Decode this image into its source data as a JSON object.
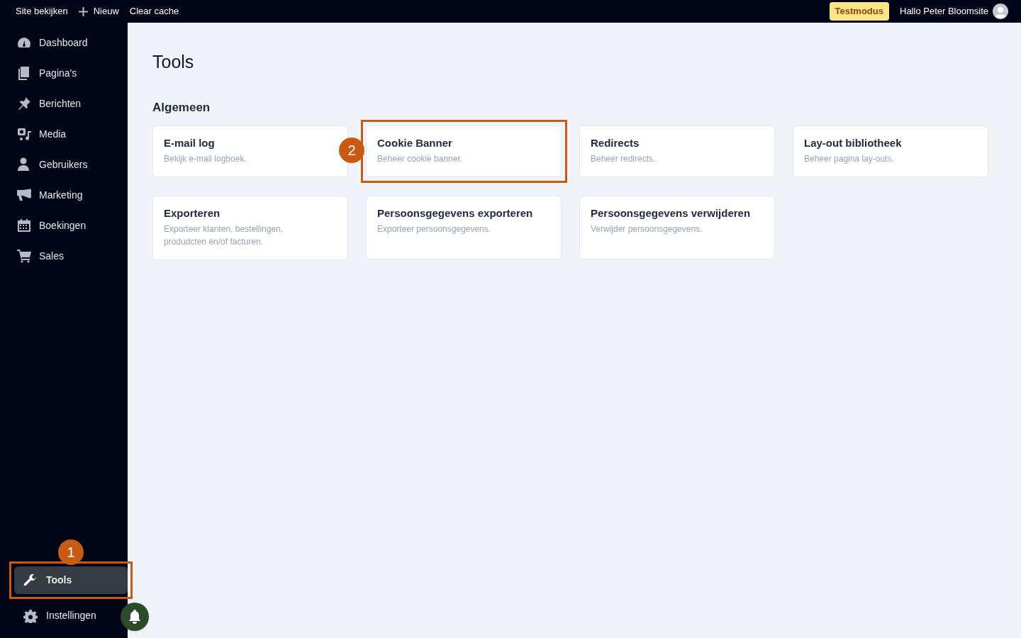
{
  "top_bar": {
    "links": [
      {
        "label": "Site bekijken",
        "kind": "plain"
      },
      {
        "label": "Nieuw",
        "kind": "add"
      },
      {
        "label": "Clear cache",
        "kind": "plain"
      }
    ],
    "badge": "Testmodus",
    "greeting": "Hallo Peter Bloomsite"
  },
  "sidebar": {
    "items": [
      {
        "label": "Dashboard",
        "selected": false
      },
      {
        "label": "Pagina's",
        "selected": false
      },
      {
        "label": "Berichten",
        "selected": false
      },
      {
        "label": "Media",
        "selected": false
      },
      {
        "label": "Gebruikers",
        "selected": false
      },
      {
        "label": "Marketing",
        "selected": false
      },
      {
        "label": "Boekingen",
        "selected": false
      },
      {
        "label": "Sales",
        "selected": false
      }
    ],
    "bottom_items": [
      {
        "label": "Tools",
        "selected": true,
        "highlighted": true,
        "callout": "1"
      },
      {
        "label": "Instellingen",
        "selected": false,
        "highlighted": false
      }
    ]
  },
  "page": {
    "title": "Tools",
    "section": "Algemeen",
    "cards": [
      {
        "title": "E-mail log",
        "description": "Bekijk e-mail logboek.",
        "highlighted": false
      },
      {
        "title": "Cookie Banner",
        "description": "Beheer cookie banner.",
        "highlighted": true,
        "callout": "2"
      },
      {
        "title": "Redirects",
        "description": "Beheer redirects.",
        "highlighted": false
      },
      {
        "title": "Lay-out bibliotheek",
        "description": "Beheer pagina lay-outs.",
        "highlighted": false
      },
      {
        "title": "Exporteren",
        "description": "Exporteer klanten, bestellingen, produdcten en/of facturen.",
        "highlighted": false
      },
      {
        "title": "Persoonsgegevens exporteren",
        "description": "Exporteer persoonsgegevens.",
        "highlighted": false
      },
      {
        "title": "Persoonsgegevens verwijderen",
        "description": "Verwijder persoonsgegevens.",
        "highlighted": false
      }
    ]
  }
}
